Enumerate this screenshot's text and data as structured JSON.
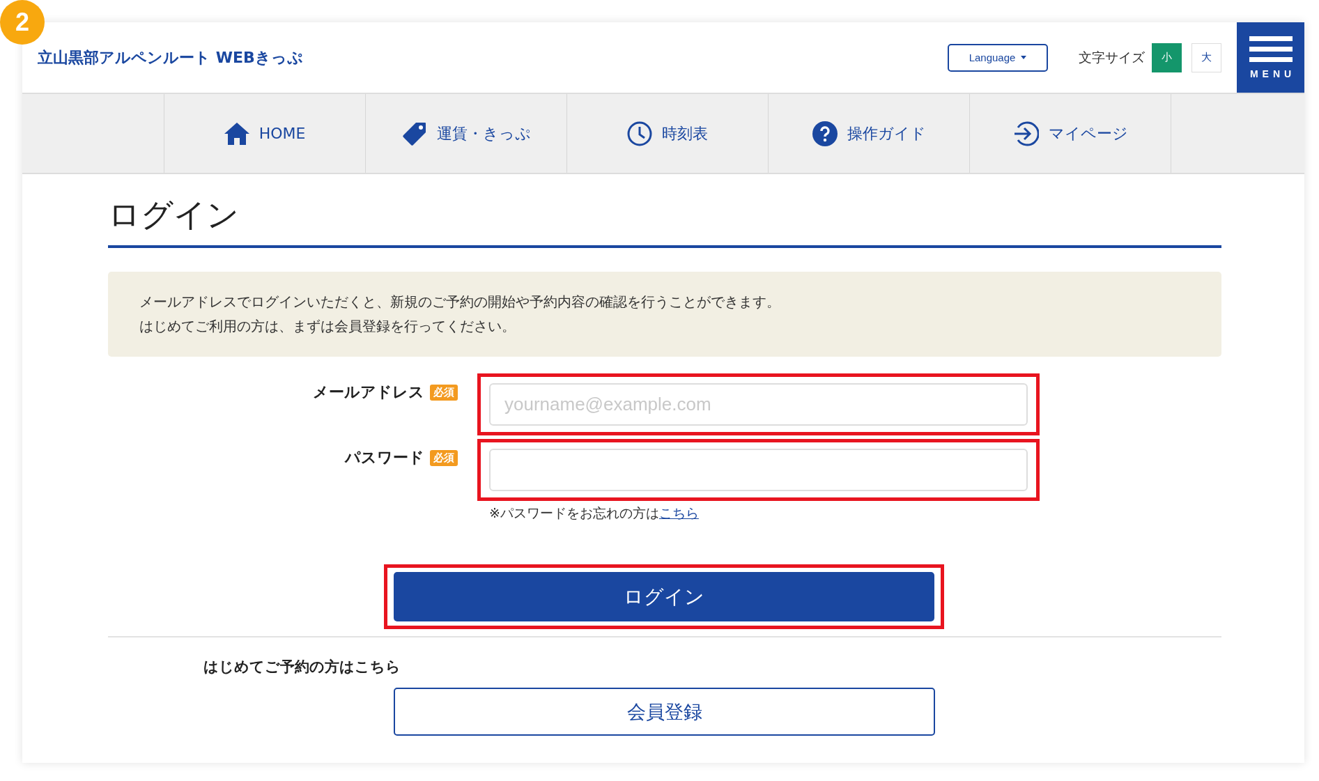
{
  "step_badge": "2",
  "header": {
    "site_title": "立山黒部アルペンルート WEBきっぷ",
    "language_button": "Language",
    "font_size_label": "文字サイズ",
    "font_sizes": [
      {
        "label": "小",
        "selected": true
      },
      {
        "label": "大",
        "selected": false
      }
    ],
    "menu_label": "MENU"
  },
  "nav": [
    {
      "label": "HOME"
    },
    {
      "label": "運賃・きっぷ"
    },
    {
      "label": "時刻表"
    },
    {
      "label": "操作ガイド"
    },
    {
      "label": "マイページ"
    }
  ],
  "page_title": "ログイン",
  "notice": [
    "メールアドレスでログインいただくと、新規のご予約の開始や予約内容の確認を行うことができます。",
    "はじめてご利用の方は、まずは会員登録を行ってください。"
  ],
  "fields": [
    {
      "label": "メールアドレス",
      "required": "必須",
      "placeholder": "yourname@example.com",
      "highlighted": true
    },
    {
      "label": "パスワード",
      "required": "必須",
      "highlighted": true
    }
  ],
  "forgot": {
    "text": "※パスワードをお忘れの方は",
    "link": "こちら"
  },
  "login_button": {
    "label": "ログイン",
    "highlighted": true
  },
  "first_time": "はじめてご予約の方はこちら",
  "register_button": "会員登録"
}
